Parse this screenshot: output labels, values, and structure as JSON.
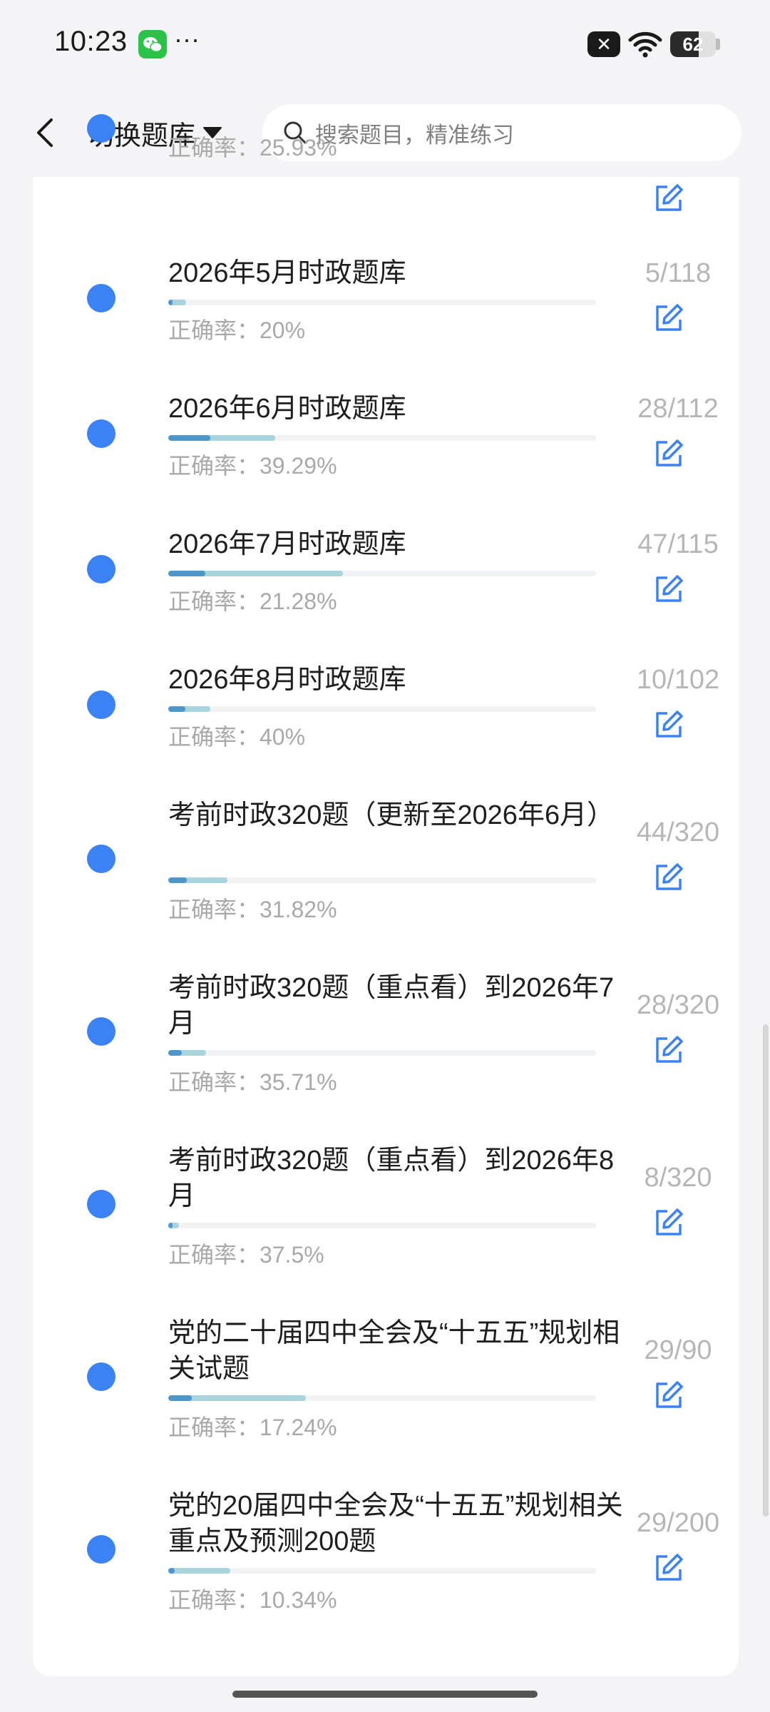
{
  "status_bar": {
    "time": "10:23",
    "dots": "···",
    "battery": "62",
    "battery_level": 0.62,
    "icons": [
      "wechat-icon",
      "close-badge-icon",
      "wifi-icon",
      "battery-icon"
    ]
  },
  "header": {
    "back_icon": "chevron-left-icon",
    "switch_label": "切换题库",
    "search_placeholder": "搜索题目，精准练习"
  },
  "accent": "#3a82f6",
  "items": [
    {
      "title": "",
      "accuracy": "正确率：25.93%",
      "count": "",
      "done": 0,
      "total": 0
    },
    {
      "title": "2026年5月时政题库",
      "accuracy": "正确率：20%",
      "count": "5/118",
      "done": 5,
      "total": 118
    },
    {
      "title": "2026年6月时政题库",
      "accuracy": "正确率：39.29%",
      "count": "28/112",
      "done": 28,
      "total": 112
    },
    {
      "title": "2026年7月时政题库",
      "accuracy": "正确率：21.28%",
      "count": "47/115",
      "done": 47,
      "total": 115
    },
    {
      "title": "2026年8月时政题库",
      "accuracy": "正确率：40%",
      "count": "10/102",
      "done": 10,
      "total": 102
    },
    {
      "title": "考前时政320题（更新至2026年6月）",
      "accuracy": "正确率：31.82%",
      "count": "44/320",
      "done": 44,
      "total": 320
    },
    {
      "title": "考前时政320题（重点看）到2026年7月",
      "accuracy": "正确率：35.71%",
      "count": "28/320",
      "done": 28,
      "total": 320
    },
    {
      "title": "考前时政320题（重点看）到2026年8月",
      "accuracy": "正确率：37.5%",
      "count": "8/320",
      "done": 8,
      "total": 320
    },
    {
      "title": "党的二十届四中全会及“十五五”规划相关试题",
      "accuracy": "正确率：17.24%",
      "count": "29/90",
      "done": 29,
      "total": 90
    },
    {
      "title": "党的20届四中全会及“十五五”规划相关重点及预测200题",
      "accuracy": "正确率：10.34%",
      "count": "29/200",
      "done": 29,
      "total": 200
    }
  ]
}
